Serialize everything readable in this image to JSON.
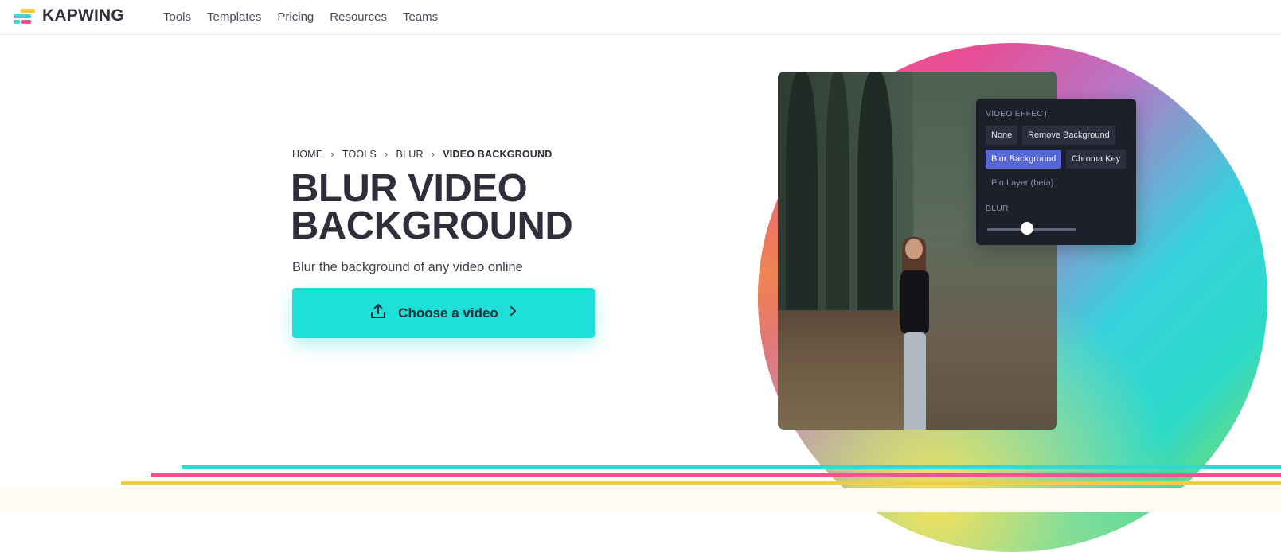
{
  "brand": {
    "name": "KAPWING"
  },
  "nav": {
    "items": [
      "Tools",
      "Templates",
      "Pricing",
      "Resources",
      "Teams"
    ]
  },
  "breadcrumb": [
    "HOME",
    "TOOLS",
    "BLUR",
    "VIDEO BACKGROUND"
  ],
  "breadcrumb_separator": "›",
  "hero": {
    "title_line1": "BLUR VIDEO",
    "title_line2": "BACKGROUND",
    "subtitle": "Blur the background of any video online",
    "cta_label": "Choose a video"
  },
  "effect_panel": {
    "heading": "VIDEO EFFECT",
    "options": [
      "None",
      "Remove Background",
      "Blur Background",
      "Chroma Key",
      "Pin Layer (beta)"
    ],
    "selected": "Blur Background",
    "slider_label": "BLUR",
    "slider_value_fraction": 0.45
  },
  "colors": {
    "accent_teal": "#1ee0d8",
    "accent_pink": "#e8578f",
    "accent_yellow": "#f3cc45",
    "selected_chip": "#5867d6",
    "panel_bg": "#1d1f2b"
  },
  "icons": [
    "upload-icon",
    "chevron-right-icon",
    "chevron-separator-icon"
  ]
}
